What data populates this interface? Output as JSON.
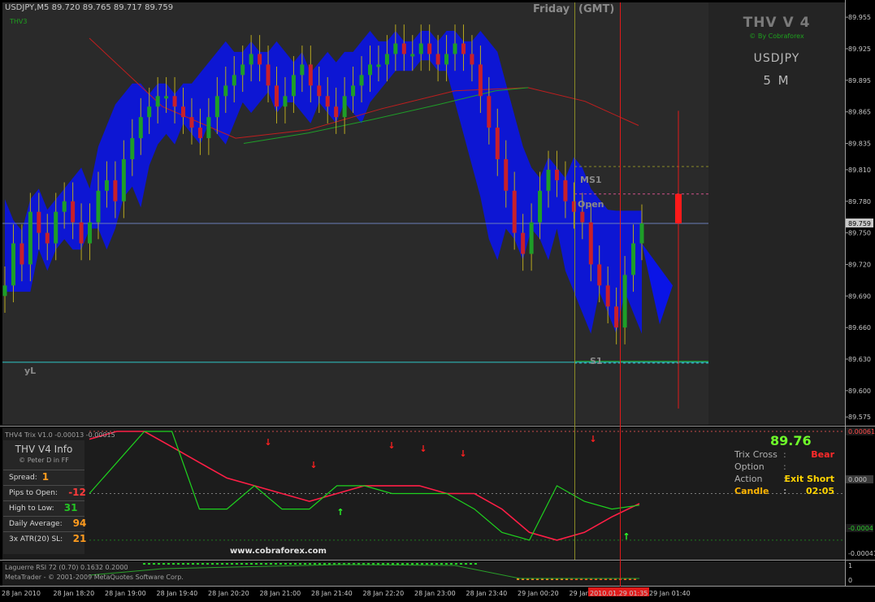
{
  "window": {
    "header": "USDJPY,M5  89.720 89.765 89.717 89.759",
    "subheader": "THV3"
  },
  "session": {
    "day": "Friday",
    "tz": "(GMT)"
  },
  "brand": {
    "title": "THV V 4",
    "credit": "© By Cobraforex",
    "symbol": "USDJPY",
    "timeframe": "5 M"
  },
  "levels": {
    "ms1": "MS1",
    "open": "Open",
    "s1": "S1",
    "yl": "yL"
  },
  "info_panel": {
    "title": "THV  V4  Info",
    "credit": "© Peter D  in FF",
    "rows": [
      {
        "label": "Spread:",
        "value": "1",
        "color": "#ff9b1e"
      },
      {
        "label": "Pips to Open:",
        "value": "-12",
        "color": "#ff3b3b"
      },
      {
        "label": "High to Low:",
        "value": "31",
        "color": "#24c424"
      },
      {
        "label": "Daily Average:",
        "value": "94",
        "color": "#ff9b1e"
      },
      {
        "label": "3x ATR(20) SL:",
        "value": "21",
        "color": "#ff9b1e"
      }
    ],
    "website": "www.cobraforex.com"
  },
  "trix_panel": {
    "header": "THV4 Trix V1.0 -0.00013 -0.00015",
    "price": "89.76",
    "rows": [
      {
        "label": "Trix Cross",
        "sep": ":",
        "value": "Bear",
        "label_color": "#b0b0b0",
        "value_color": "#ff2a2a"
      },
      {
        "label": "Option",
        "sep": ":",
        "value": "",
        "label_color": "#b0b0b0",
        "value_color": "#b0b0b0"
      },
      {
        "label": "Action",
        "sep": ":",
        "value": "Exit Short",
        "label_color": "#b0b0b0",
        "value_color": "#ffd400"
      },
      {
        "label": "Candle",
        "sep": ":",
        "value": "02:05",
        "label_color": "#ffb400",
        "value_color": "#ffd400"
      }
    ]
  },
  "laguerre_panel": {
    "header": "Laguerre RSI 72 (0.70) 0.1632 0.2000",
    "copyright": "MetaTrader - © 2001-2009 MetaQuotes Software Corp."
  },
  "colors": {
    "background": "#000000",
    "chart_bg": "#2a2a2a",
    "bull": "#1e9e28",
    "bear": "#c8202a",
    "cloud": "#0a14e6",
    "trix_fast": "#ff1e46",
    "trix_slow": "#1ed21e",
    "current_price": "#6a7fb8"
  },
  "chart_data": {
    "type": "line",
    "symbol": "USDJPY",
    "timeframe": "M5",
    "y_ticks": [
      "89.955",
      "89.925",
      "89.895",
      "89.865",
      "89.835",
      "89.810",
      "89.780",
      "89.759",
      "89.750",
      "89.720",
      "89.690",
      "89.660",
      "89.630",
      "89.600",
      "89.575"
    ],
    "ylim": [
      89.569,
      89.969
    ],
    "current_price": 89.759,
    "levels": [
      {
        "name": "MS1",
        "value": 89.813
      },
      {
        "name": "Open",
        "value": 89.787
      },
      {
        "name": "S1",
        "value": 89.628
      },
      {
        "name": "yL",
        "value": 89.627
      }
    ],
    "x_ticks": [
      "28 Jan 2010",
      "28 Jan 18:20",
      "28 Jan 19:00",
      "28 Jan 19:40",
      "28 Jan 20:20",
      "28 Jan 21:00",
      "28 Jan 21:40",
      "28 Jan 22:20",
      "28 Jan 23:00",
      "28 Jan 23:40",
      "29 Jan 00:20",
      "29 Jan 01:00",
      "2010.01.29 01:35",
      "29 Jan 01:40"
    ],
    "candles_close": [
      89.7,
      89.74,
      89.72,
      89.77,
      89.75,
      89.74,
      89.77,
      89.78,
      89.76,
      89.74,
      89.76,
      89.79,
      89.8,
      89.78,
      89.82,
      89.84,
      89.86,
      89.87,
      89.88,
      89.88,
      89.87,
      89.86,
      89.85,
      89.84,
      89.86,
      89.88,
      89.89,
      89.9,
      89.91,
      89.92,
      89.91,
      89.89,
      89.87,
      89.88,
      89.9,
      89.91,
      89.89,
      89.88,
      89.87,
      89.86,
      89.88,
      89.89,
      89.9,
      89.91,
      89.91,
      89.92,
      89.93,
      89.92,
      89.92,
      89.93,
      89.92,
      89.91,
      89.92,
      89.93,
      89.92,
      89.91,
      89.88,
      89.85,
      89.82,
      89.79,
      89.75,
      89.73,
      89.76,
      89.79,
      89.81,
      89.8,
      89.78,
      89.77,
      89.76,
      89.72,
      89.7,
      89.68,
      89.66,
      89.71,
      89.74,
      89.759
    ],
    "trix": {
      "series": [
        {
          "name": "fast",
          "values": [
            0.0007,
            0.0008,
            0.0008,
            0.0006,
            0.0004,
            0.0002,
            0.0001,
            0.0,
            -0.0001,
            0.0,
            0.0001,
            0.0001,
            0.0001,
            0.0,
            0.0,
            -0.0002,
            -0.0005,
            -0.0006,
            -0.0005,
            -0.0003,
            -0.00013
          ]
        },
        {
          "name": "slow",
          "values": [
            0.0,
            0.0004,
            0.0008,
            0.0008,
            -0.0002,
            -0.0002,
            0.0001,
            -0.0002,
            -0.0002,
            0.0001,
            0.0001,
            0.0,
            0.0,
            0.0,
            -0.0002,
            -0.0005,
            -0.0006,
            0.0001,
            -0.0001,
            -0.0002,
            -0.00015
          ]
        }
      ],
      "y_ticks": [
        "0.00061",
        "0.000",
        "-0.0004",
        "-0.00041"
      ]
    },
    "laguerre": {
      "value": 0.1632,
      "level": 0.2,
      "y_ticks": [
        "1",
        "0"
      ]
    }
  }
}
